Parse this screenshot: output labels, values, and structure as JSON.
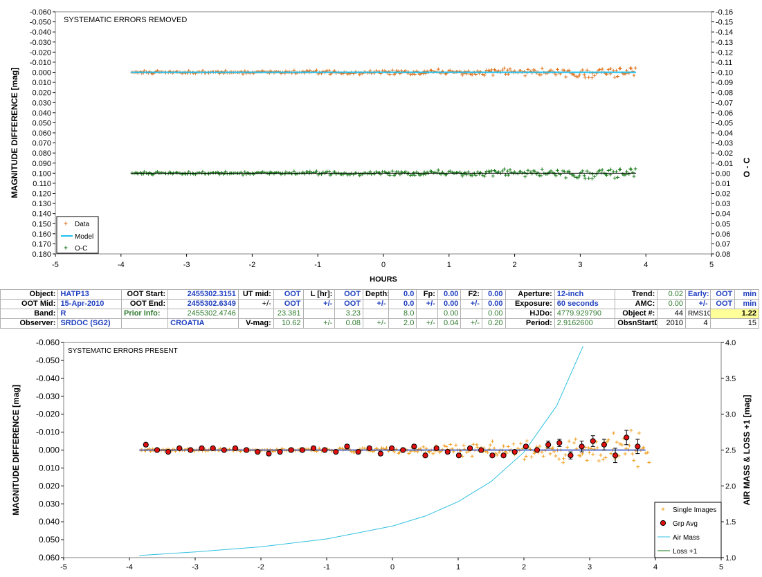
{
  "top_chart": {
    "label": "SYSTEMATIC ERRORS REMOVED",
    "left_axis_title": "MAGNITUDE DIFFERENCE [mag]",
    "right_axis_title": "O - C",
    "x_axis_title": "HOURS",
    "x_ticks": [
      "-5",
      "-4",
      "-3",
      "-2",
      "-1",
      "0",
      "1",
      "2",
      "3",
      "4",
      "5"
    ],
    "y_left_ticks": [
      "-0.060",
      "-0.050",
      "-0.040",
      "-0.030",
      "-0.020",
      "-0.010",
      "0.000",
      "0.010",
      "0.020",
      "0.030",
      "0.040",
      "0.050",
      "0.060",
      "0.070",
      "0.080",
      "0.090",
      "0.100",
      "0.110",
      "0.120",
      "0.130",
      "0.140",
      "0.150",
      "0.160",
      "0.170",
      "0.180"
    ],
    "y_right_ticks": [
      "-0.16",
      "-0.15",
      "-0.14",
      "-0.13",
      "-0.12",
      "-0.11",
      "-0.10",
      "-0.09",
      "-0.08",
      "-0.07",
      "-0.06",
      "-0.05",
      "-0.04",
      "-0.03",
      "-0.02",
      "-0.01",
      "0.00",
      "0.01",
      "0.02",
      "0.03",
      "0.04",
      "0.05",
      "0.06",
      "0.07",
      "0.08"
    ],
    "legend": [
      "Data",
      "Model",
      "O-C"
    ],
    "colors": {
      "data": "#e0701a",
      "model": "#1ec0f0",
      "oc": "#1a7a1a",
      "oc_line": "#000000"
    }
  },
  "info": {
    "r1": [
      "Object:",
      "HATP13",
      "OOT Start:",
      "2455302.3151",
      "UT mid:",
      "OOT",
      "L [hr]:",
      "OOT",
      "Depth:",
      "0.0",
      "Fp:",
      "0.00",
      "F2:",
      "0.00",
      "Aperture:",
      "12-inch",
      "Trend:",
      "0.02",
      "Early:",
      "OOT",
      "min"
    ],
    "r2": [
      "OOT Mid:",
      "15-Apr-2010",
      "OOT End:",
      "2455302.6349",
      "+/-",
      "OOT",
      "+/-",
      "OOT",
      "+/-",
      "0.0",
      "+/-",
      "0.00",
      "+/-",
      "0.00",
      "Exposure:",
      "60 seconds",
      "AMC:",
      "0.00",
      "+/-",
      "OOT",
      "min"
    ],
    "r3": [
      "Band:",
      "R",
      "Prior Info:",
      "2455302.4746",
      "23.381",
      "3.23",
      "8.0",
      "0.00",
      "0.00",
      "HJDo:",
      "4779.929790",
      "Object #:",
      "44",
      "RMS10",
      "1.22"
    ],
    "r4": [
      "Observer:",
      "SRDOC (SG2)",
      "CROATIA",
      "V-mag:",
      "10.62",
      "+/-",
      "0.08",
      "+/-",
      "2.0",
      "+/-",
      "0.04",
      "+/-",
      "0.20",
      "Period:",
      "2.9162600",
      "ObsnStartDate:",
      "2010",
      "4",
      "15"
    ]
  },
  "bottom_chart": {
    "label": "SYSTEMATIC ERRORS PRESENT",
    "left_axis_title": "MAGNITUDE DIFFERENCE [mag]",
    "right_axis_title": "AIR MASS & LOSS +1 [mag]",
    "x_ticks": [
      "-5",
      "-4",
      "-3",
      "-2",
      "-1",
      "0",
      "1",
      "2",
      "3",
      "4",
      "5"
    ],
    "y_left_ticks": [
      "-0.060",
      "-0.050",
      "-0.040",
      "-0.030",
      "-0.020",
      "-0.010",
      "0.000",
      "0.010",
      "0.020",
      "0.030",
      "0.040",
      "0.050",
      "0.060"
    ],
    "y_right_ticks": [
      "4.0",
      "3.5",
      "3.0",
      "2.5",
      "2.0",
      "1.5",
      "1.0"
    ],
    "legend": [
      "Single Images",
      "Grp Avg",
      "Air Mass",
      "Loss +1"
    ],
    "colors": {
      "single": "#f0a020",
      "grp": "#e01010",
      "airmass": "#30c0e0",
      "model": "#2040c0",
      "loss": "#1a7a1a"
    }
  },
  "chart_data": [
    {
      "type": "scatter",
      "title": "SYSTEMATIC ERRORS REMOVED",
      "xlabel": "HOURS",
      "ylabel": "MAGNITUDE DIFFERENCE [mag]",
      "y2label": "O - C",
      "xlim": [
        -5,
        5
      ],
      "ylim": [
        0.18,
        -0.06
      ],
      "y2lim": [
        0.08,
        -0.16
      ],
      "grid": false,
      "legend_position": "bottom-left",
      "series": [
        {
          "name": "Data",
          "x_range": [
            -3.85,
            3.85
          ],
          "approx_level": 0.0,
          "approx_scatter": 0.004
        },
        {
          "name": "Model",
          "x": [
            -3.85,
            3.85
          ],
          "y": [
            0.0,
            0.0
          ]
        },
        {
          "name": "O-C",
          "x_range": [
            -3.85,
            3.85
          ],
          "approx_level": 0.0,
          "approx_scatter": 0.004,
          "axis": "right"
        }
      ]
    },
    {
      "type": "scatter",
      "title": "SYSTEMATIC ERRORS PRESENT",
      "ylabel": "MAGNITUDE DIFFERENCE [mag]",
      "y2label": "AIR MASS & LOSS +1 [mag]",
      "xlim": [
        -5,
        5
      ],
      "ylim": [
        0.06,
        -0.06
      ],
      "y2lim": [
        1.0,
        4.0
      ],
      "grid": false,
      "legend_position": "bottom-right",
      "series": [
        {
          "name": "Single Images",
          "x_range": [
            -3.85,
            3.9
          ],
          "approx_level": 0.0,
          "approx_scatter_start": 0.002,
          "approx_scatter_end": 0.02
        },
        {
          "name": "Grp Avg",
          "x": [
            -3.75,
            -3.58,
            -3.41,
            -3.24,
            -3.07,
            -2.9,
            -2.73,
            -2.56,
            -2.39,
            -2.22,
            -2.05,
            -1.88,
            -1.71,
            -1.54,
            -1.37,
            -1.2,
            -1.03,
            -0.86,
            -0.69,
            -0.52,
            -0.35,
            -0.18,
            -0.01,
            0.16,
            0.33,
            0.5,
            0.67,
            0.84,
            1.01,
            1.18,
            1.35,
            1.52,
            1.69,
            1.86,
            2.03,
            2.2,
            2.37,
            2.54,
            2.71,
            2.88,
            3.05,
            3.22,
            3.39,
            3.56,
            3.73
          ],
          "y": [
            -0.003,
            0.0,
            0.001,
            -0.001,
            0.0,
            -0.001,
            -0.001,
            0.0,
            -0.001,
            0.0,
            0.001,
            0.002,
            0.001,
            0.0,
            0.0,
            -0.001,
            0.0,
            0.001,
            -0.002,
            0.001,
            -0.001,
            0.002,
            -0.001,
            0.0,
            -0.002,
            0.003,
            -0.001,
            0.001,
            0.003,
            -0.001,
            0.0,
            0.003,
            0.003,
            0.001,
            -0.002,
            0.0,
            -0.003,
            -0.004,
            0.003,
            -0.002,
            -0.005,
            -0.003,
            0.003,
            -0.007,
            -0.002
          ],
          "error": [
            0.001,
            0.001,
            0.001,
            0.001,
            0.001,
            0.001,
            0.001,
            0.001,
            0.001,
            0.001,
            0.001,
            0.001,
            0.001,
            0.001,
            0.001,
            0.001,
            0.001,
            0.001,
            0.001,
            0.001,
            0.001,
            0.001,
            0.001,
            0.001,
            0.001,
            0.001,
            0.001,
            0.001,
            0.001,
            0.001,
            0.001,
            0.001,
            0.001,
            0.001,
            0.001,
            0.001,
            0.002,
            0.002,
            0.002,
            0.003,
            0.003,
            0.003,
            0.004,
            0.004,
            0.004
          ]
        },
        {
          "name": "Air Mass",
          "axis": "right",
          "x": [
            -3.85,
            -3.0,
            -2.0,
            -1.0,
            0.0,
            0.5,
            1.0,
            1.5,
            2.0,
            2.5,
            2.9
          ],
          "y": [
            1.03,
            1.08,
            1.15,
            1.26,
            1.44,
            1.58,
            1.78,
            2.06,
            2.47,
            3.12,
            3.95
          ]
        },
        {
          "name": "Loss +1",
          "axis": "right",
          "x": [],
          "y": []
        }
      ]
    }
  ]
}
